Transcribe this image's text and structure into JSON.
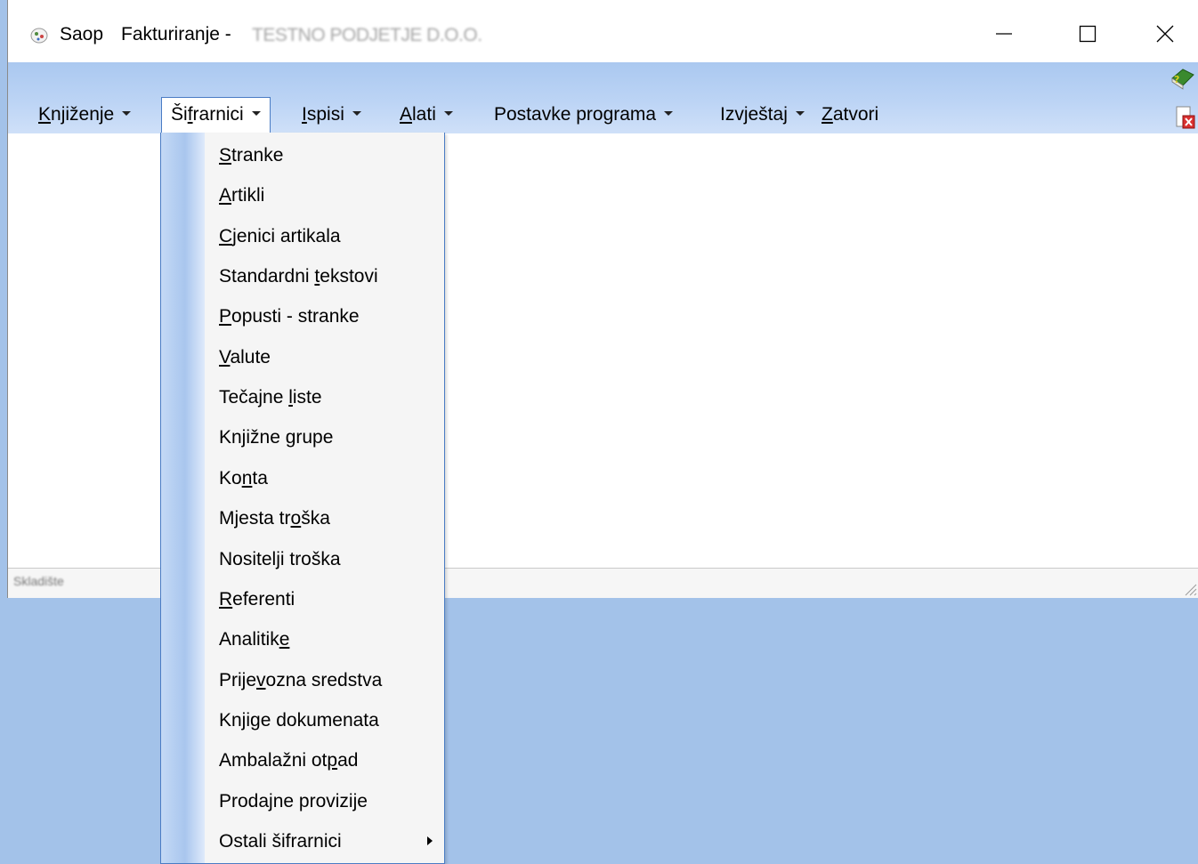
{
  "window": {
    "title": {
      "app": "Saop",
      "module": "Fakturiranje -",
      "company": "TESTNO PODJETJE D.O.O."
    }
  },
  "menubar": {
    "items": [
      {
        "pre": "",
        "ul": "K",
        "post": "njiženje"
      },
      {
        "pre": "Ši",
        "ul": "f",
        "post": "rarnici"
      },
      {
        "pre": "",
        "ul": "I",
        "post": "spisi"
      },
      {
        "pre": "",
        "ul": "A",
        "post": "lati"
      },
      {
        "pre": "Postavke programa",
        "ul": "",
        "post": ""
      },
      {
        "pre": "Izvještaj",
        "ul": "",
        "post": ""
      },
      {
        "pre": "",
        "ul": "Z",
        "post": "atvori"
      }
    ]
  },
  "dropdown": {
    "items": [
      {
        "pre": "",
        "ul": "S",
        "post": "tranke"
      },
      {
        "pre": "",
        "ul": "A",
        "post": "rtikli"
      },
      {
        "pre": "",
        "ul": "C",
        "post": "jenici artikala"
      },
      {
        "pre": "Standardni ",
        "ul": "t",
        "post": "ekstovi"
      },
      {
        "pre": "",
        "ul": "P",
        "post": "opusti - stranke"
      },
      {
        "pre": "",
        "ul": "V",
        "post": "alute"
      },
      {
        "pre": "Tečajne ",
        "ul": "l",
        "post": "iste"
      },
      {
        "pre": "Knjižne grupe",
        "ul": "",
        "post": ""
      },
      {
        "pre": "Ko",
        "ul": "n",
        "post": "ta"
      },
      {
        "pre": "Mjesta tr",
        "ul": "o",
        "post": "ška"
      },
      {
        "pre": "Nositelji troška",
        "ul": "",
        "post": ""
      },
      {
        "pre": "",
        "ul": "R",
        "post": "eferenti"
      },
      {
        "pre": "Analitik",
        "ul": "e",
        "post": ""
      },
      {
        "pre": "Prije",
        "ul": "v",
        "post": "ozna sredstva"
      },
      {
        "pre": "Knji",
        "ul": "g",
        "post": "e dokumenata"
      },
      {
        "pre": "Ambalažni ot",
        "ul": "p",
        "post": "ad"
      },
      {
        "pre": "Prodajne provizije",
        "ul": "",
        "post": ""
      },
      {
        "pre": "Ostali šifrarnici",
        "ul": "",
        "post": ""
      }
    ]
  },
  "statusbar": {
    "text": "Skladište"
  },
  "icons": {
    "app": "app-icon",
    "minimize": "minimize-icon",
    "maximize": "maximize-icon",
    "close": "close-icon",
    "help": "help-book-icon",
    "close_document": "close-document-icon",
    "submenu": "submenu-arrow-icon",
    "grip": "resize-grip-icon"
  },
  "colors": {
    "desktop": "#a3c2e9",
    "menubar": "#bcd4f5",
    "menu_border": "#4a7cc4",
    "menu_bg": "#f5f5f5"
  }
}
